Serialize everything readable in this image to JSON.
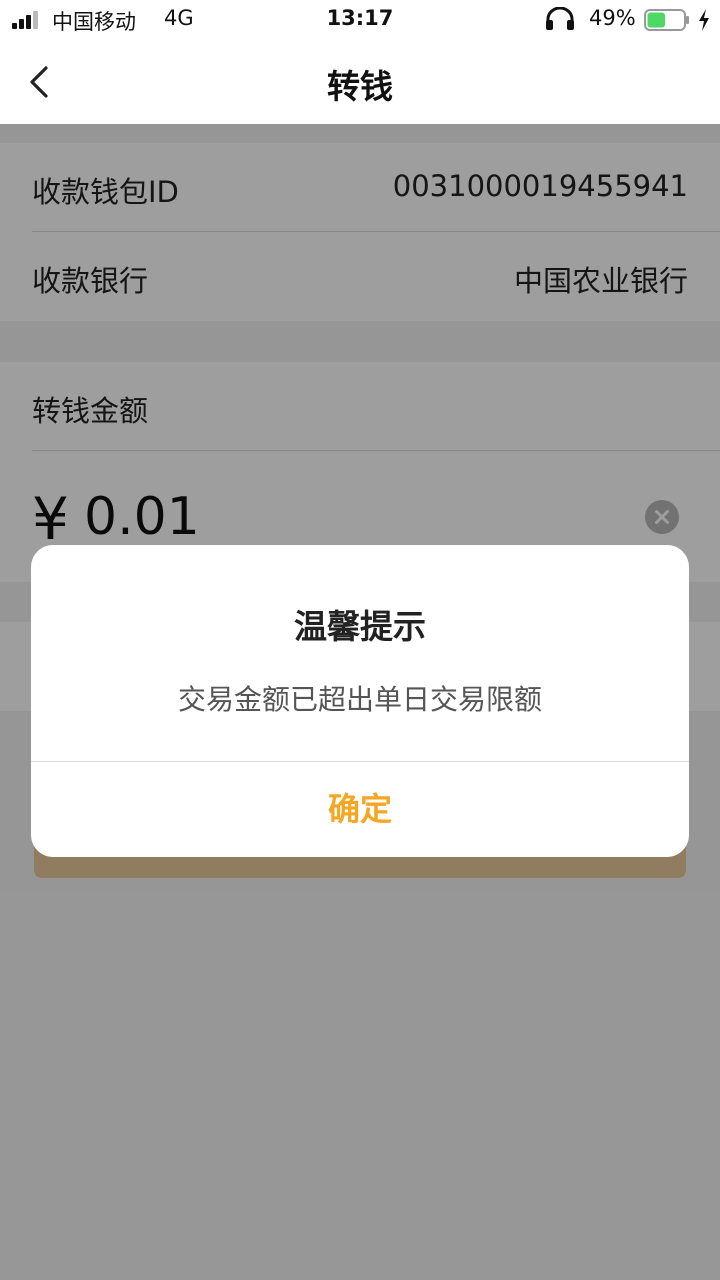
{
  "status_bar": {
    "carrier": "中国移动",
    "network": "4G",
    "time": "13:17",
    "battery_percent": "49%",
    "battery_level": 0.49,
    "signal_bars_filled": 3,
    "icons": [
      "signal-icon",
      "headphone-icon",
      "battery-icon",
      "charging-icon"
    ]
  },
  "nav": {
    "title": "转钱",
    "back_icon": "chevron-left-icon"
  },
  "form": {
    "wallet_id_label": "收款钱包ID",
    "wallet_id_value": "0031000019455941",
    "bank_label": "收款银行",
    "bank_value": "中国农业银行",
    "amount_label": "转钱金额",
    "currency_symbol": "¥",
    "amount_value": "0.01"
  },
  "dialog": {
    "title": "温馨提示",
    "message": "交易金额已超出单日交易限额",
    "confirm_label": "确定"
  },
  "colors": {
    "accent": "#f5a623",
    "button_bg": "#e9c998",
    "overlay": "rgba(0,0,0,0.38)"
  }
}
